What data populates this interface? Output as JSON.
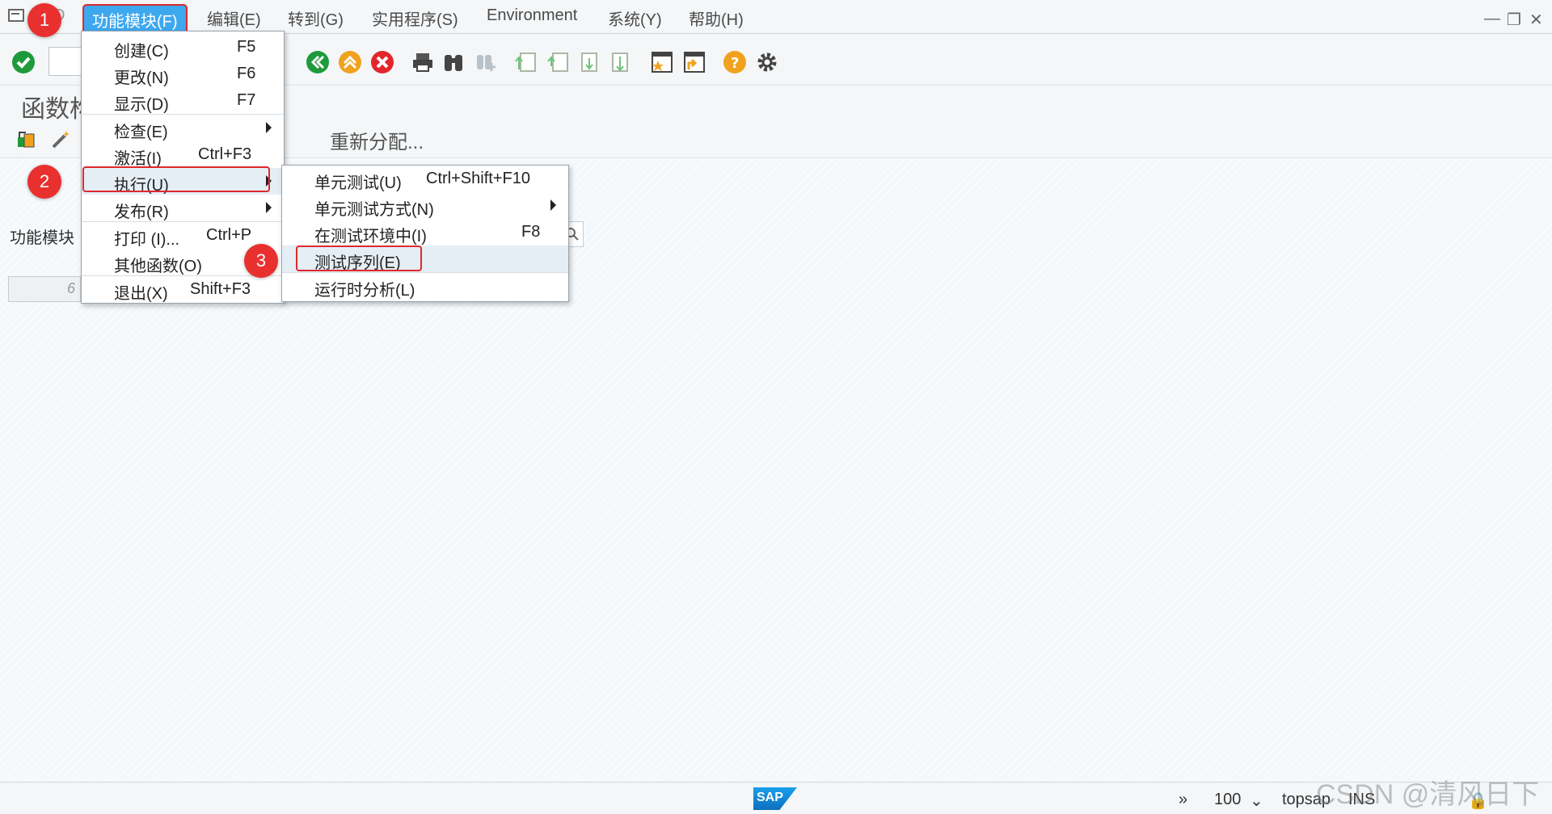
{
  "menubar": {
    "items": [
      "功能模块(F)",
      "编辑(E)",
      "转到(G)",
      "实用程序(S)",
      "Environment",
      "系统(Y)",
      "帮助(H)"
    ],
    "partial_item": "D"
  },
  "page": {
    "title": "函数构",
    "reassign_label": "重新分配...",
    "field_label": "功能模块",
    "row_value": "6"
  },
  "menu_main": [
    {
      "label": "创建(C)",
      "shortcut": "F5"
    },
    {
      "label": "更改(N)",
      "shortcut": "F6"
    },
    {
      "label": "显示(D)",
      "shortcut": "F7"
    },
    {
      "label": "检查(E)",
      "shortcut": "",
      "submenu": true
    },
    {
      "label": "激活(I)",
      "shortcut": "Ctrl+F3"
    },
    {
      "label": "执行(U)",
      "shortcut": "",
      "submenu": true
    },
    {
      "label": "发布(R)",
      "shortcut": "",
      "submenu": true
    },
    {
      "label": "打印 (I)...",
      "shortcut": "Ctrl+P"
    },
    {
      "label": "其他函数(O)",
      "shortcut": ""
    },
    {
      "label": "退出(X)",
      "shortcut": "Shift+F3"
    }
  ],
  "menu_sub": [
    {
      "label": "单元测试(U)",
      "shortcut": "Ctrl+Shift+F10"
    },
    {
      "label": "单元测试方式(N)",
      "shortcut": "",
      "submenu": true
    },
    {
      "label": "在测试环境中(I)",
      "shortcut": "F8"
    },
    {
      "label": "测试序列(E)",
      "shortcut": ""
    },
    {
      "label": "运行时分析(L)",
      "shortcut": ""
    }
  ],
  "badges": [
    "1",
    "2",
    "3"
  ],
  "statusbar": {
    "zoom": "100",
    "user": "topsap",
    "mode": "INS",
    "logo": "SAP"
  },
  "watermark": "CSDN @清风日下",
  "colors": {
    "highlight": "#3ea8ef",
    "badge": "#e8302f",
    "outline": "#e0282e"
  }
}
